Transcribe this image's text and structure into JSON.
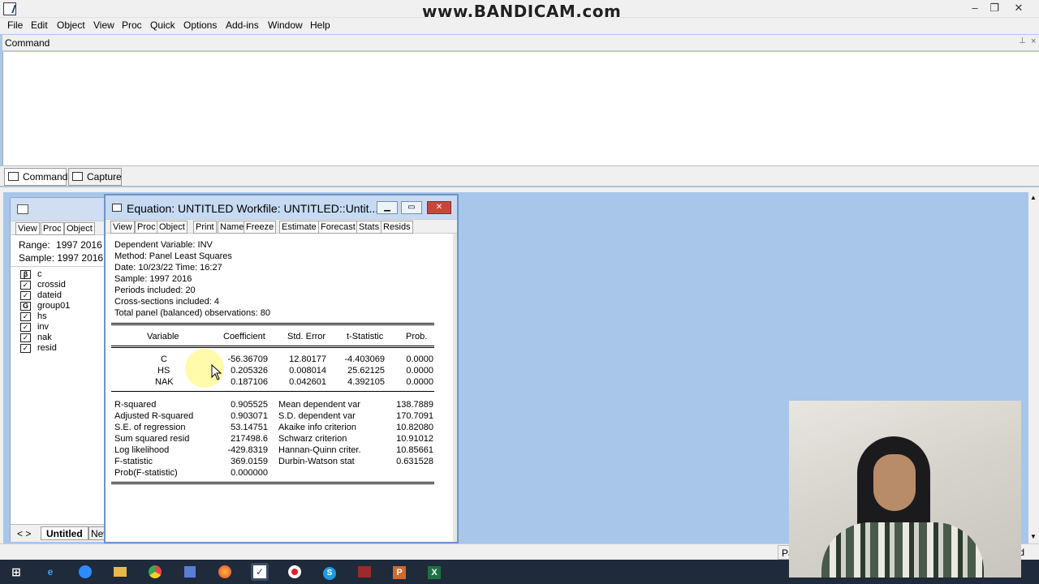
{
  "titlebar": {
    "watermark": "www.BANDICAM.com",
    "minimize": "–",
    "restore": "❐",
    "close": "✕"
  },
  "menu": [
    "File",
    "Edit",
    "Object",
    "View",
    "Proc",
    "Quick",
    "Options",
    "Add-ins",
    "Window",
    "Help"
  ],
  "command": {
    "header": "Command",
    "tabs": [
      "Command",
      "Capture"
    ]
  },
  "workfile": {
    "buttons": [
      "View",
      "Proc",
      "Object"
    ],
    "range_label": "Range:",
    "range_value": "1997 2016",
    "sample_label": "Sample:",
    "sample_value": "1997 2016",
    "objects": [
      {
        "icon": "β",
        "name": "c"
      },
      {
        "icon": "✓",
        "name": "crossid"
      },
      {
        "icon": "✓",
        "name": "dateid"
      },
      {
        "icon": "G",
        "name": "group01"
      },
      {
        "icon": "✓",
        "name": "hs"
      },
      {
        "icon": "✓",
        "name": "inv"
      },
      {
        "icon": "✓",
        "name": "nak"
      },
      {
        "icon": "✓",
        "name": "resid"
      }
    ],
    "tabs": {
      "nav": "< >",
      "active": "Untitled",
      "next": "New"
    }
  },
  "equation": {
    "title": "Equation: UNTITLED   Workfile: UNTITLED::Untit...",
    "buttons": [
      "View",
      "Proc",
      "Object",
      "Print",
      "Name",
      "Freeze",
      "Estimate",
      "Forecast",
      "Stats",
      "Resids"
    ],
    "header": [
      "Dependent Variable: INV",
      "Method: Panel Least Squares",
      "Date: 10/23/22   Time: 16:27",
      "Sample: 1997 2016",
      "Periods included: 20",
      "Cross-sections included: 4",
      "Total panel (balanced) observations: 80"
    ],
    "columns": [
      "Variable",
      "Coefficient",
      "Std. Error",
      "t-Statistic",
      "Prob."
    ],
    "rows": [
      [
        "C",
        "-56.36709",
        "12.80177",
        "-4.403069",
        "0.0000"
      ],
      [
        "HS",
        "0.205326",
        "0.008014",
        "25.62125",
        "0.0000"
      ],
      [
        "NAK",
        "0.187106",
        "0.042601",
        "4.392105",
        "0.0000"
      ]
    ],
    "stats": [
      [
        "R-squared",
        "0.905525",
        "Mean dependent var",
        "138.7889"
      ],
      [
        "Adjusted R-squared",
        "0.903071",
        "S.D. dependent var",
        "170.7091"
      ],
      [
        "S.E. of regression",
        "53.14751",
        "Akaike info criterion",
        "10.82080"
      ],
      [
        "Sum squared resid",
        "217498.6",
        "Schwarz criterion",
        "10.91012"
      ],
      [
        "Log likelihood",
        "-429.8319",
        "Hannan-Quinn criter.",
        "10.85661"
      ],
      [
        "F-statistic",
        "369.0159",
        "Durbin-Watson stat",
        "0.631528"
      ],
      [
        "Prob(F-statistic)",
        "0.000000",
        "",
        ""
      ]
    ]
  },
  "statusbar": {
    "left": "Pa",
    "right": "ltled"
  },
  "taskbar": [
    "start-icon",
    "edge-icon",
    "zoom-icon",
    "files-icon",
    "chrome-icon",
    "calculator-icon",
    "firefox-icon",
    "eviews-icon",
    "bandicam-icon",
    "skype-icon",
    "archive-icon",
    "powerpoint-icon",
    "excel-icon"
  ]
}
